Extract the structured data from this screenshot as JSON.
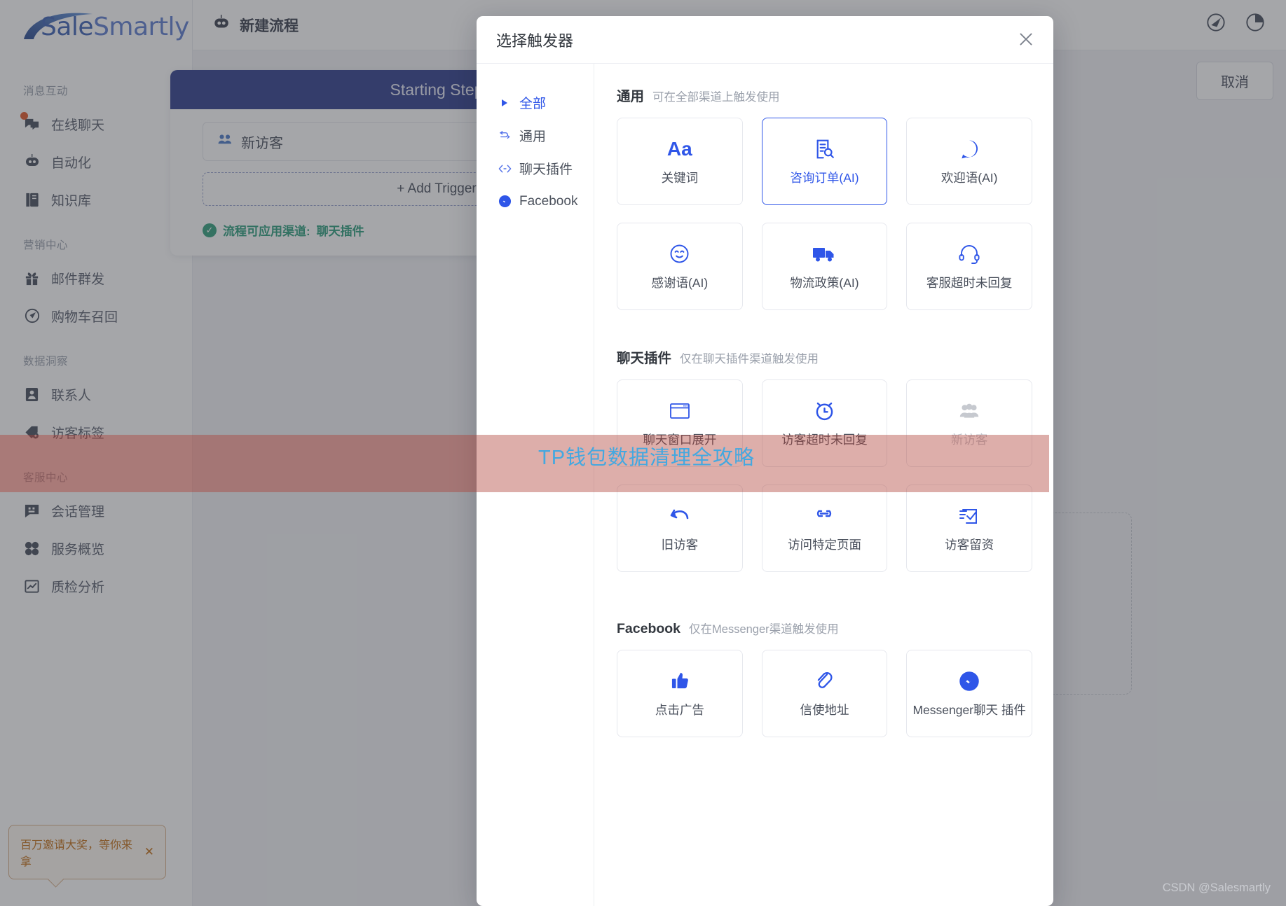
{
  "brand": {
    "name_part1": "Sale",
    "name_part2": "Smartly"
  },
  "sidebar": {
    "groups": [
      {
        "label": "消息互动",
        "items": [
          {
            "label": "在线聊天",
            "icon": "chat-bubbles-icon",
            "badge": true
          },
          {
            "label": "自动化",
            "icon": "robot-icon",
            "badge": false
          },
          {
            "label": "知识库",
            "icon": "book-icon",
            "badge": false
          }
        ]
      },
      {
        "label": "营销中心",
        "items": [
          {
            "label": "邮件群发",
            "icon": "gift-icon",
            "badge": false
          },
          {
            "label": "购物车召回",
            "icon": "cart-recall-icon",
            "badge": false
          }
        ]
      },
      {
        "label": "数据洞察",
        "items": [
          {
            "label": "联系人",
            "icon": "contact-card-icon",
            "badge": false
          },
          {
            "label": "访客标签",
            "icon": "tag-gear-icon",
            "badge": false
          }
        ]
      },
      {
        "label": "客服中心",
        "items": [
          {
            "label": "会话管理",
            "icon": "conversation-icon",
            "badge": false
          },
          {
            "label": "服务概览",
            "icon": "grid-icon",
            "badge": false
          },
          {
            "label": "质检分析",
            "icon": "chart-box-icon",
            "badge": false
          }
        ]
      }
    ]
  },
  "topbar": {
    "title": "新建流程",
    "icons": [
      "compass-icon",
      "pie-chart-icon"
    ]
  },
  "canvas": {
    "cancel_label": "取消",
    "flow": {
      "step_title": "Starting Step",
      "trigger_chip": "新访客",
      "add_trigger_label": "+ Add Trigger",
      "note_prefix": "流程可应用渠道:",
      "note_value": "聊天插件"
    }
  },
  "promo_toast": {
    "text": "百万邀请大奖，等你来拿",
    "close": "✕"
  },
  "modal": {
    "title": "选择触发器",
    "close_icon": "close-icon",
    "nav": [
      {
        "label": "全部",
        "icon": "triangle-right-icon",
        "active": true
      },
      {
        "label": "通用",
        "icon": "shuffle-icon",
        "active": false
      },
      {
        "label": "聊天插件",
        "icon": "code-arrows-icon",
        "active": false
      },
      {
        "label": "Facebook",
        "icon": "messenger-icon",
        "active": false
      }
    ],
    "sections": [
      {
        "title": "通用",
        "subtitle": "可在全部渠道上触发使用",
        "cards": [
          {
            "label": "关键词",
            "icon": "aa-text-icon",
            "selected": false,
            "disabled": false
          },
          {
            "label": "咨询订单(AI)",
            "icon": "document-search-icon",
            "selected": true,
            "disabled": false
          },
          {
            "label": "欢迎语(AI)",
            "icon": "hi-bubble-icon",
            "selected": false,
            "disabled": false
          },
          {
            "label": "感谢语(AI)",
            "icon": "smile-face-icon",
            "selected": false,
            "disabled": false
          },
          {
            "label": "物流政策(AI)",
            "icon": "truck-icon",
            "selected": false,
            "disabled": false
          },
          {
            "label": "客服超时未回复",
            "icon": "headset-icon",
            "selected": false,
            "disabled": false
          }
        ]
      },
      {
        "title": "聊天插件",
        "subtitle": "仅在聊天插件渠道触发使用",
        "cards": [
          {
            "label": "聊天窗口展开",
            "icon": "window-icon",
            "selected": false,
            "disabled": false
          },
          {
            "label": "访客超时未回复",
            "icon": "alarm-clock-icon",
            "selected": false,
            "disabled": false
          },
          {
            "label": "新访客",
            "icon": "new-visitors-icon",
            "selected": false,
            "disabled": true
          },
          {
            "label": "旧访客",
            "icon": "return-arrow-icon",
            "selected": false,
            "disabled": false
          },
          {
            "label": "访问特定页面",
            "icon": "link-icon",
            "selected": false,
            "disabled": false
          },
          {
            "label": "访客留资",
            "icon": "form-check-icon",
            "selected": false,
            "disabled": false
          }
        ]
      },
      {
        "title": "Facebook",
        "subtitle": "仅在Messenger渠道触发使用",
        "cards": [
          {
            "label": "点击广告",
            "icon": "thumbs-up-icon",
            "selected": false,
            "disabled": false
          },
          {
            "label": "信使地址",
            "icon": "paperclip-link-icon",
            "selected": false,
            "disabled": false
          },
          {
            "label": "Messenger聊天\n插件",
            "icon": "messenger-icon",
            "selected": false,
            "disabled": false
          }
        ]
      }
    ]
  },
  "watermark": {
    "text": "TP钱包数据清理全攻略",
    "credit": "CSDN @Salesmartly"
  },
  "colors": {
    "accent": "#2f56e8",
    "step_header": "#32408f",
    "note_green": "#2f9e7e",
    "promo_orange": "#c4711b",
    "watermark_band": "rgba(174,62,52,.42)",
    "watermark_text": "#44a8e0"
  }
}
